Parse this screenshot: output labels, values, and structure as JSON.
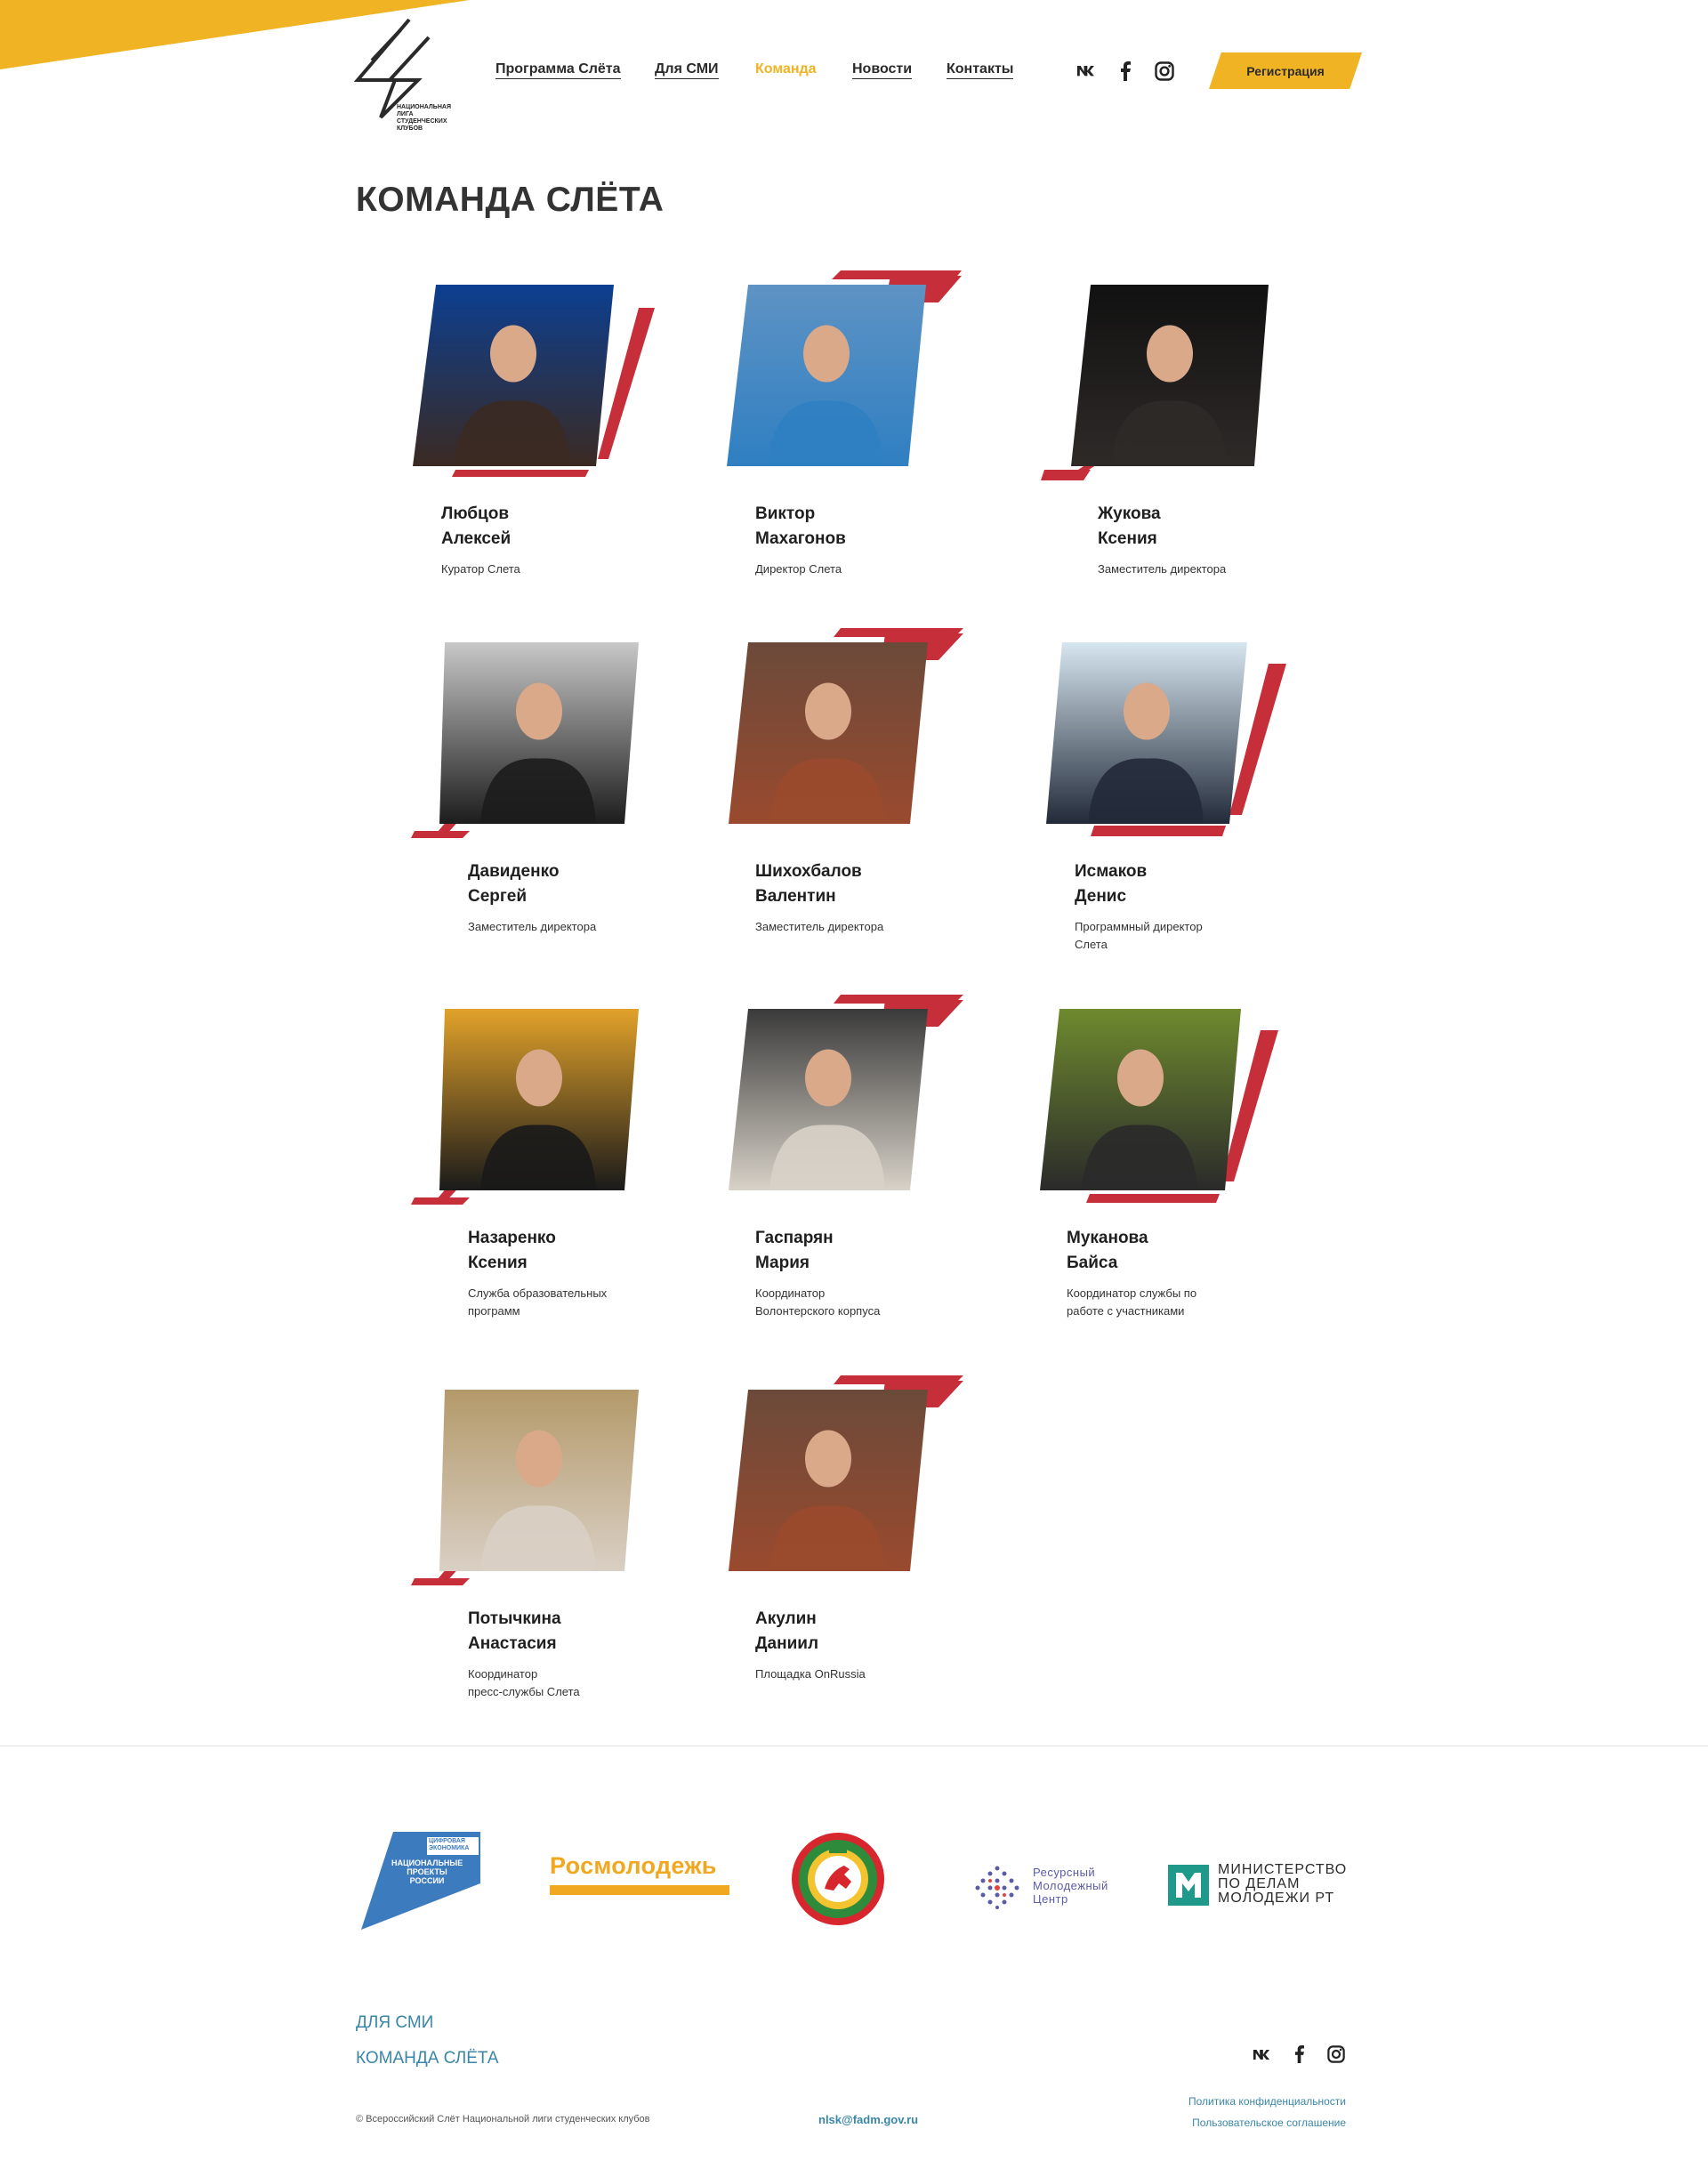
{
  "header": {
    "logo_text": "Национальная лига студенческих клубов",
    "nav": [
      "Программа Слёта",
      "Для СМИ",
      "Команда",
      "Новости",
      "Контакты"
    ],
    "active_nav": "Команда",
    "register_label": "Регистрация",
    "social_icons": [
      "vk-icon",
      "facebook-icon",
      "instagram-icon"
    ]
  },
  "page": {
    "title": "КОМАНДА СЛЁТА"
  },
  "team": [
    {
      "name": "Любцов\nАлексей",
      "role": "Куратор Слета"
    },
    {
      "name": "Виктор\nМахагонов",
      "role": "Директор Слета"
    },
    {
      "name": "Жукова\nКсения",
      "role": "Заместитель директора"
    },
    {
      "name": "Давиденко\nСергей",
      "role": "Заместитель директора"
    },
    {
      "name": "Шихохбалов\nВалентин",
      "role": "Заместитель директора"
    },
    {
      "name": "Исмаков\nДенис",
      "role": "Программный директор\nСлета"
    },
    {
      "name": "Назаренко\nКсения",
      "role": "Служба образовательных\nпрограмм"
    },
    {
      "name": "Гаспарян\nМария",
      "role": "Координатор\nВолонтерского корпуса"
    },
    {
      "name": "Муканова\nБайса",
      "role": "Координатор службы по\nработе с участниками"
    },
    {
      "name": "Потычкина\nАнастасия",
      "role": "Координатор\nпресс-службы Слета"
    },
    {
      "name": "Акулин\nДаниил",
      "role": "Площадка OnRussia"
    }
  ],
  "partners": {
    "natproj": {
      "line1": "ЦИФРОВАЯ",
      "line2": "ЭКОНОМИКА",
      "line3": "НАЦИОНАЛЬНЫЕ",
      "line4": "ПРОЕКТЫ",
      "line5": "РОССИИ"
    },
    "rosmol": "Росмолодежь",
    "rmc": {
      "line1": "Ресурсный",
      "line2": "Молодежный",
      "line3": "Центр"
    },
    "ministry": {
      "line1": "МИНИСТЕРСТВО",
      "line2": "ПО ДЕЛАМ",
      "line3": "МОЛОДЕЖИ РТ"
    }
  },
  "footer": {
    "links": [
      "ДЛЯ СМИ",
      "КОМАНДА СЛЁТА"
    ],
    "copyright": "© Всероссийский Слёт Национальной лиги студенческих клубов",
    "email": "nlsk@fadm.gov.ru",
    "privacy": "Политика конфиденциальности",
    "agreement": "Пользовательское соглашение"
  },
  "colors": {
    "accent": "#f0b323",
    "deco_red": "#c62f3a",
    "link": "#3a86a8"
  }
}
